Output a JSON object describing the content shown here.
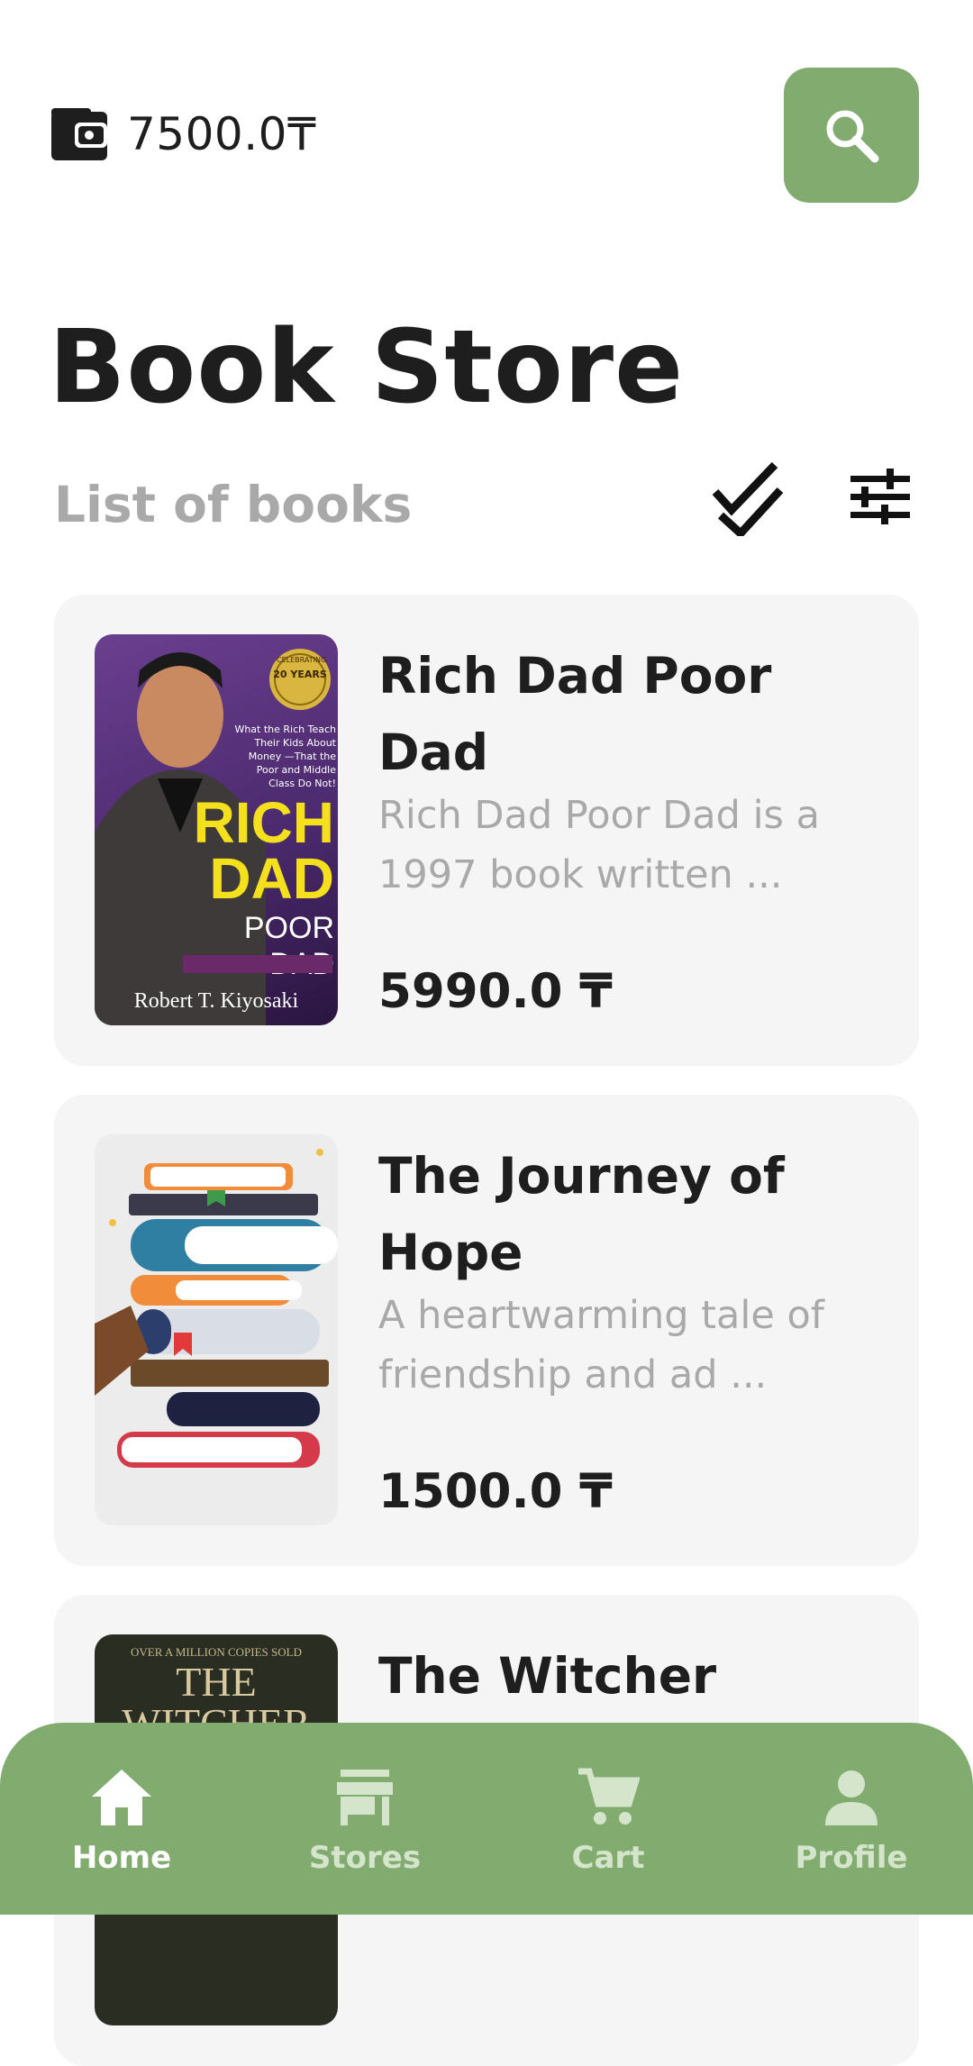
{
  "wallet": {
    "icon": "wallet-icon",
    "amount": "7500.0₸"
  },
  "search": {
    "icon": "search-icon"
  },
  "header": {
    "title": "Book Store",
    "subtitle": "List of books"
  },
  "toolbar": {
    "sort_icon": "sort-icon",
    "filter_icon": "filter-sliders-icon"
  },
  "books": [
    {
      "title": "Rich Dad Poor Dad",
      "description": "Rich Dad Poor Dad is a 1997 book written ...",
      "price": "5990.0 ₸",
      "cover": {
        "top_text": "What the Rich Teach Their Kids About Money —That the Poor and Middle Class Do Not!",
        "badge_big": "20 YEARS",
        "badge_small": "CELEBRATING",
        "big1": "RICH",
        "big2": "DAD",
        "big3": "POOR DAD",
        "author": "Robert T. Kiyosaki"
      }
    },
    {
      "title": "The Journey of Hope",
      "description": "A heartwarming tale of friendship and ad ...",
      "price": "1500.0 ₸",
      "cover": {
        "illustration": "stack-of-books-illustration"
      }
    },
    {
      "title": "The Witcher",
      "description": "",
      "price": "",
      "cover": {
        "top_text": "OVER A MILLION COPIES SOLD",
        "title_text": "THE WITCHER"
      }
    }
  ],
  "nav": [
    {
      "label": "Home",
      "icon": "home-icon",
      "active": true
    },
    {
      "label": "Stores",
      "icon": "store-icon",
      "active": false
    },
    {
      "label": "Cart",
      "icon": "cart-icon",
      "active": false
    },
    {
      "label": "Profile",
      "icon": "person-icon",
      "active": false
    }
  ],
  "colors": {
    "accent": "#82ac6f",
    "card": "#f5f5f5",
    "muted_text": "#a9a9a9",
    "text": "#1e1e1e"
  }
}
